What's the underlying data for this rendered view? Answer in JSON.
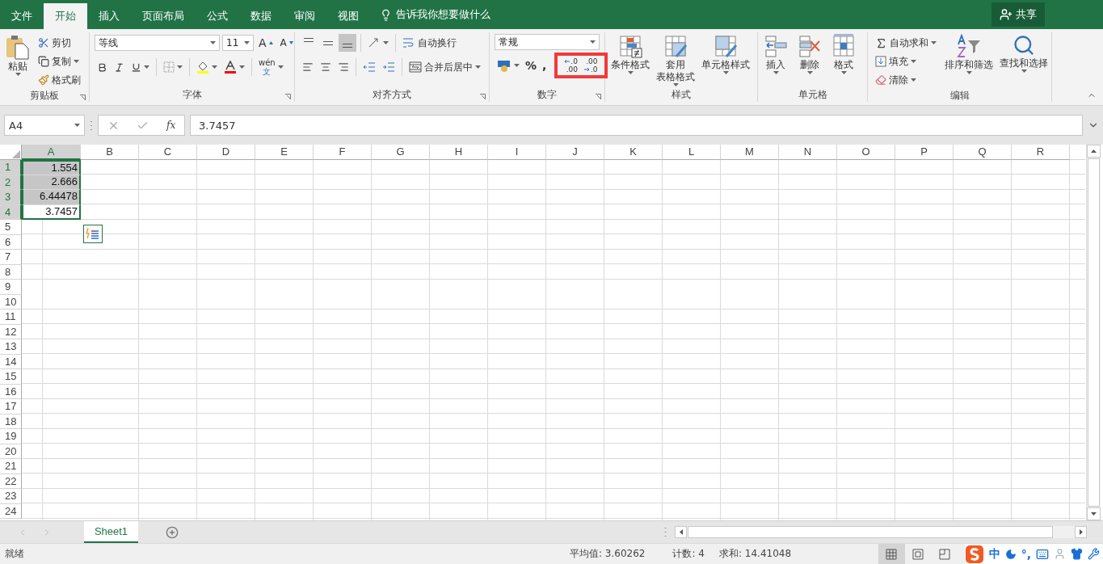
{
  "menu_tabs": [
    {
      "label": "文件",
      "selected": false
    },
    {
      "label": "开始",
      "selected": true
    },
    {
      "label": "插入",
      "selected": false
    },
    {
      "label": "页面布局",
      "selected": false
    },
    {
      "label": "公式",
      "selected": false
    },
    {
      "label": "数据",
      "selected": false
    },
    {
      "label": "审阅",
      "selected": false
    },
    {
      "label": "视图",
      "selected": false
    }
  ],
  "tell_me": "告诉我你想要做什么",
  "share": "共享",
  "clipboard": {
    "label": "剪贴板",
    "paste": "粘贴",
    "cut": "剪切",
    "copy": "复制",
    "format_painter": "格式刷"
  },
  "font": {
    "label": "字体",
    "font_name": "等线",
    "font_size": "11",
    "grow": "A",
    "shrink": "A",
    "phonetic_top": "wén",
    "phonetic_bottom": "文"
  },
  "alignment": {
    "label": "对齐方式",
    "vertical_align": [
      {
        "selected": false
      },
      {
        "selected": false
      },
      {
        "selected": true
      }
    ],
    "wrap": "自动换行",
    "merge": "合并后居中"
  },
  "number": {
    "label": "数字",
    "format": "常规",
    "percent": "%",
    "comma": ",",
    "decimals": {
      "highlighted": true,
      "items": [
        {
          "kind": "increase",
          "top": ".0",
          "bottom": ".00"
        },
        {
          "kind": "decrease",
          "top": ".00",
          "bottom": ".0"
        }
      ]
    }
  },
  "styles": {
    "label": "样式",
    "buttons": [
      {
        "kind": "conditional",
        "lines": [
          "条件格式"
        ]
      },
      {
        "kind": "table",
        "lines": [
          "套用",
          "表格格式"
        ]
      },
      {
        "kind": "cellstyle",
        "lines": [
          "单元格样式"
        ]
      }
    ]
  },
  "cells": {
    "label": "单元格",
    "buttons": [
      {
        "kind": "insert",
        "label": "插入"
      },
      {
        "kind": "delete",
        "label": "删除"
      },
      {
        "kind": "format",
        "label": "格式"
      }
    ]
  },
  "editing": {
    "label": "编辑",
    "autosum": "自动求和",
    "fill": "填充",
    "clear": "清除",
    "sort": "排序和筛选",
    "find": "查找和选择"
  },
  "formula_bar": {
    "name_box": "A4",
    "fx": "fx",
    "value": "3.7457"
  },
  "columns": [
    {
      "label": "A",
      "selected": true
    },
    {
      "label": "B",
      "selected": false
    },
    {
      "label": "C",
      "selected": false
    },
    {
      "label": "D",
      "selected": false
    },
    {
      "label": "E",
      "selected": false
    },
    {
      "label": "F",
      "selected": false
    },
    {
      "label": "G",
      "selected": false
    },
    {
      "label": "H",
      "selected": false
    },
    {
      "label": "I",
      "selected": false
    },
    {
      "label": "J",
      "selected": false
    },
    {
      "label": "K",
      "selected": false
    },
    {
      "label": "L",
      "selected": false
    },
    {
      "label": "M",
      "selected": false
    },
    {
      "label": "N",
      "selected": false
    },
    {
      "label": "O",
      "selected": false
    },
    {
      "label": "P",
      "selected": false
    },
    {
      "label": "Q",
      "selected": false
    },
    {
      "label": "R",
      "selected": false
    }
  ],
  "rows": [
    {
      "label": "1",
      "selected": true,
      "cells": [
        {
          "text": "1.554",
          "selected": true,
          "active": false
        }
      ]
    },
    {
      "label": "2",
      "selected": true,
      "cells": [
        {
          "text": "2.666",
          "selected": true,
          "active": false
        }
      ]
    },
    {
      "label": "3",
      "selected": true,
      "cells": [
        {
          "text": "6.44478",
          "selected": true,
          "active": false
        }
      ]
    },
    {
      "label": "4",
      "selected": true,
      "cells": [
        {
          "text": "3.7457",
          "selected": true,
          "active": true
        }
      ]
    },
    {
      "label": "5",
      "selected": false,
      "cells": []
    },
    {
      "label": "6",
      "selected": false,
      "cells": []
    },
    {
      "label": "7",
      "selected": false,
      "cells": []
    },
    {
      "label": "8",
      "selected": false,
      "cells": []
    },
    {
      "label": "9",
      "selected": false,
      "cells": []
    },
    {
      "label": "10",
      "selected": false,
      "cells": []
    },
    {
      "label": "11",
      "selected": false,
      "cells": []
    },
    {
      "label": "12",
      "selected": false,
      "cells": []
    },
    {
      "label": "13",
      "selected": false,
      "cells": []
    },
    {
      "label": "14",
      "selected": false,
      "cells": []
    },
    {
      "label": "15",
      "selected": false,
      "cells": []
    },
    {
      "label": "16",
      "selected": false,
      "cells": []
    },
    {
      "label": "17",
      "selected": false,
      "cells": []
    },
    {
      "label": "18",
      "selected": false,
      "cells": []
    },
    {
      "label": "19",
      "selected": false,
      "cells": []
    },
    {
      "label": "20",
      "selected": false,
      "cells": []
    },
    {
      "label": "21",
      "selected": false,
      "cells": []
    },
    {
      "label": "22",
      "selected": false,
      "cells": []
    },
    {
      "label": "23",
      "selected": false,
      "cells": []
    },
    {
      "label": "24",
      "selected": false,
      "cells": []
    }
  ],
  "sheet_tabs": [
    {
      "label": "Sheet1",
      "selected": true
    }
  ],
  "status_bar": {
    "ready": "就绪",
    "average": "平均值: 3.60262",
    "count": "计数: 4",
    "sum": "求和: 14.41048",
    "views": [
      {
        "kind": "normal",
        "selected": true
      },
      {
        "kind": "page_layout",
        "selected": false
      },
      {
        "kind": "page_break",
        "selected": false
      }
    ],
    "ime_mode": "中",
    "ime_punct": "°,"
  }
}
